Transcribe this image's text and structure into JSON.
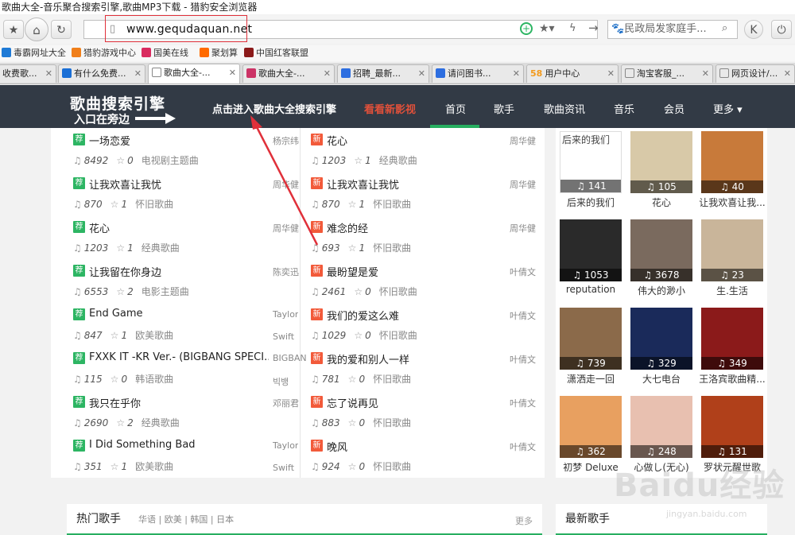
{
  "window": {
    "title": "歌曲大全-音乐聚合搜索引擎,歌曲MP3下载 - 猎豹安全浏览器"
  },
  "navbar": {
    "url": "www.gequdaquan.net",
    "search_placeholder": "民政局发家庭手..."
  },
  "bookmarks": [
    {
      "label": "毒霸网址大全",
      "color": "#1e7ad6"
    },
    {
      "label": "猎豹游戏中心",
      "color": "#f07f1a"
    },
    {
      "label": "国美在线",
      "color": "#d92b5f"
    },
    {
      "label": "聚划算",
      "color": "#ff6a00"
    },
    {
      "label": "中国红客联盟",
      "color": "#8b1a1a"
    }
  ],
  "tabs": [
    {
      "label": "收费歌...",
      "active": false,
      "color": "#888"
    },
    {
      "label": "有什么免费...",
      "active": false,
      "color": "#1a6fd6"
    },
    {
      "label": "歌曲大全-...",
      "active": true,
      "color": "#888"
    },
    {
      "label": "歌曲大全-...",
      "active": false,
      "color": "#cc3366"
    },
    {
      "label": "招聘_最新...",
      "active": false,
      "color": "#2d6ee0"
    },
    {
      "label": "请问图书...",
      "active": false,
      "color": "#2d6ee0"
    },
    {
      "label": "用户中心",
      "active": false,
      "color": "#f29a1d"
    },
    {
      "label": "淘宝客服_...",
      "active": false,
      "color": "#888"
    },
    {
      "label": "网页设计/...",
      "active": false,
      "color": "#888"
    }
  ],
  "site": {
    "logo_line1": "歌曲搜索引擎",
    "logo_line2": "入口在旁边",
    "nav": [
      "点击进入歌曲大全搜索引擎",
      "看看新影视",
      "首页",
      "歌手",
      "歌曲资讯",
      "音乐",
      "会员",
      "更多"
    ]
  },
  "songs_left": [
    {
      "badge": "荐",
      "title": "一场恋爱",
      "artist": "杨宗纬",
      "plays": "8492",
      "likes": "0",
      "category": "电视剧主题曲"
    },
    {
      "badge": "荐",
      "title": "让我欢喜让我忧",
      "artist": "周华健",
      "plays": "870",
      "likes": "1",
      "category": "怀旧歌曲"
    },
    {
      "badge": "荐",
      "title": "花心",
      "artist": "周华健",
      "plays": "1203",
      "likes": "1",
      "category": "经典歌曲"
    },
    {
      "badge": "荐",
      "title": "让我留在你身边",
      "artist": "陈奕迅",
      "plays": "6553",
      "likes": "2",
      "category": "电影主题曲"
    },
    {
      "badge": "荐",
      "title": "End Game",
      "artist": "Taylor",
      "artist2": "Swift",
      "plays": "847",
      "likes": "1",
      "category": "欧美歌曲"
    },
    {
      "badge": "荐",
      "title": "FXXK IT -KR Ver.- (BIGBANG SPECI...",
      "artist": "BIGBAN",
      "artist2": "빅뱅",
      "plays": "115",
      "likes": "0",
      "category": "韩语歌曲"
    },
    {
      "badge": "荐",
      "title": "我只在乎你",
      "artist": "邓丽君",
      "plays": "2690",
      "likes": "2",
      "category": "经典歌曲"
    },
    {
      "badge": "荐",
      "title": "I Did Something Bad",
      "artist": "Taylor",
      "artist2": "Swift",
      "plays": "351",
      "likes": "1",
      "category": "欧美歌曲"
    }
  ],
  "songs_right": [
    {
      "badge": "新",
      "title": "花心",
      "artist": "周华健",
      "plays": "1203",
      "likes": "1",
      "category": "经典歌曲"
    },
    {
      "badge": "新",
      "title": "让我欢喜让我忧",
      "artist": "周华健",
      "plays": "870",
      "likes": "1",
      "category": "怀旧歌曲"
    },
    {
      "badge": "新",
      "title": "难念的经",
      "artist": "周华健",
      "plays": "693",
      "likes": "1",
      "category": "怀旧歌曲"
    },
    {
      "badge": "新",
      "title": "最盼望是爱",
      "artist": "叶倩文",
      "plays": "2461",
      "likes": "0",
      "category": "怀旧歌曲"
    },
    {
      "badge": "新",
      "title": "我们的爱这么难",
      "artist": "叶倩文",
      "plays": "1029",
      "likes": "0",
      "category": "怀旧歌曲"
    },
    {
      "badge": "新",
      "title": "我的爱和别人一样",
      "artist": "叶倩文",
      "plays": "781",
      "likes": "0",
      "category": "怀旧歌曲"
    },
    {
      "badge": "新",
      "title": "忘了说再见",
      "artist": "叶倩文",
      "plays": "883",
      "likes": "0",
      "category": "怀旧歌曲"
    },
    {
      "badge": "新",
      "title": "晚风",
      "artist": "叶倩文",
      "plays": "924",
      "likes": "0",
      "category": "怀旧歌曲"
    }
  ],
  "albums": [
    {
      "label": "后来的我们",
      "count": "141",
      "alt": "后来的我们",
      "color": "#ffffff"
    },
    {
      "label": "花心",
      "count": "105",
      "alt": "",
      "color": "#d8c9a8"
    },
    {
      "label": "让我欢喜让我...",
      "count": "40",
      "alt": "",
      "color": "#c87a3a"
    },
    {
      "label": "reputation",
      "count": "1053",
      "alt": "",
      "color": "#2a2a2a"
    },
    {
      "label": "伟大的渺小",
      "count": "3678",
      "alt": "",
      "color": "#7a6a5e"
    },
    {
      "label": "生.生活",
      "count": "23",
      "alt": "",
      "color": "#c9b59a"
    },
    {
      "label": "潇洒走一回",
      "count": "739",
      "alt": "",
      "color": "#8b6a4a"
    },
    {
      "label": "大七电台",
      "count": "329",
      "alt": "",
      "color": "#1a2a5a"
    },
    {
      "label": "王洛宾歌曲精...",
      "count": "349",
      "alt": "",
      "color": "#8b1a1a"
    },
    {
      "label": "初梦 Deluxe",
      "count": "362",
      "alt": "",
      "color": "#e8a060"
    },
    {
      "label": "心做し(无心)",
      "count": "248",
      "alt": "",
      "color": "#e8c0b0"
    },
    {
      "label": "罗状元醒世歌",
      "count": "131",
      "alt": "",
      "color": "#b0401a"
    }
  ],
  "bottom": {
    "hot_singers": "热门歌手",
    "hot_tags": "华语 | 欧美 | 韩国 | 日本",
    "more": "更多",
    "new_songs": "最新歌手"
  },
  "watermark": {
    "brand": "Baidu经验",
    "url": "jingyan.baidu.com"
  }
}
